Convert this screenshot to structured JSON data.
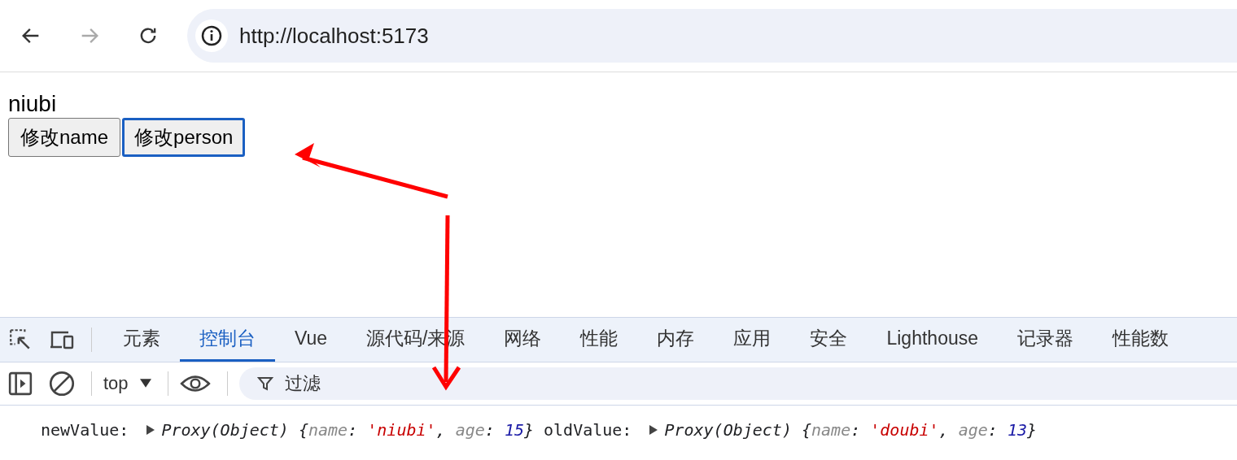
{
  "browser": {
    "url": "http://localhost:5173",
    "back_disabled": false,
    "forward_disabled": true
  },
  "page": {
    "text": "niubi",
    "buttons": [
      {
        "label": "修改name",
        "focused": false
      },
      {
        "label": "修改person",
        "focused": true
      }
    ]
  },
  "devtools": {
    "tabs": [
      {
        "label": "元素",
        "selected": false
      },
      {
        "label": "控制台",
        "selected": true
      },
      {
        "label": "Vue",
        "selected": false
      },
      {
        "label": "源代码/来源",
        "selected": false
      },
      {
        "label": "网络",
        "selected": false
      },
      {
        "label": "性能",
        "selected": false
      },
      {
        "label": "内存",
        "selected": false
      },
      {
        "label": "应用",
        "selected": false
      },
      {
        "label": "安全",
        "selected": false
      },
      {
        "label": "Lighthouse",
        "selected": false
      },
      {
        "label": "记录器",
        "selected": false
      },
      {
        "label": "性能数",
        "selected": false
      }
    ],
    "context": "top",
    "filter_placeholder": "过滤",
    "console": [
      {
        "label": "newValue:",
        "parts": [
          {
            "text": "Proxy(Object) {",
            "kind": "plain"
          },
          {
            "text": "name",
            "kind": "key"
          },
          {
            "text": ": ",
            "kind": "plain"
          },
          {
            "text": "'niubi'",
            "kind": "string"
          },
          {
            "text": ", ",
            "kind": "plain"
          },
          {
            "text": "age",
            "kind": "key"
          },
          {
            "text": ": ",
            "kind": "plain"
          },
          {
            "text": "15",
            "kind": "number"
          },
          {
            "text": "}",
            "kind": "plain"
          }
        ]
      },
      {
        "label": "oldValue:",
        "parts": [
          {
            "text": "Proxy(Object) {",
            "kind": "plain"
          },
          {
            "text": "name",
            "kind": "key"
          },
          {
            "text": ": ",
            "kind": "plain"
          },
          {
            "text": "'doubi'",
            "kind": "string"
          },
          {
            "text": ", ",
            "kind": "plain"
          },
          {
            "text": "age",
            "kind": "key"
          },
          {
            "text": ": ",
            "kind": "plain"
          },
          {
            "text": "13",
            "kind": "number"
          },
          {
            "text": "}",
            "kind": "plain"
          }
        ]
      }
    ]
  }
}
